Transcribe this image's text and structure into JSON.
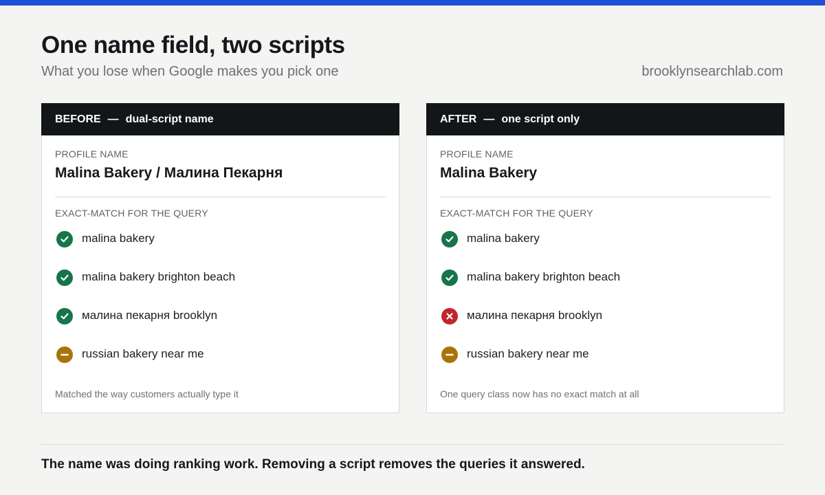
{
  "colors": {
    "accent": "#1d4ed8",
    "match": "#16754a",
    "no_match": "#c0262d",
    "partial": "#a8740a",
    "header_bg": "#131619"
  },
  "header": {
    "title": "One name field, two scripts",
    "subtitle": "What you lose when Google makes you pick one",
    "site": "brooklynsearchlab.com"
  },
  "cards": [
    {
      "tag": "BEFORE",
      "separator": "—",
      "heading": "dual-script name",
      "profile_label": "PROFILE NAME",
      "profile_name": "Malina Bakery / Малина Пекарня",
      "exact_label": "EXACT-MATCH FOR THE QUERY",
      "queries": [
        {
          "text": "malina bakery",
          "status": "match",
          "icon": "check-circle-icon"
        },
        {
          "text": "malina bakery brighton beach",
          "status": "match",
          "icon": "check-circle-icon"
        },
        {
          "text": "малина пекарня brooklyn",
          "status": "match",
          "icon": "check-circle-icon"
        },
        {
          "text": "russian bakery near me",
          "status": "partial",
          "icon": "minus-circle-icon"
        }
      ],
      "note": "Matched the way customers actually type it"
    },
    {
      "tag": "AFTER",
      "separator": "—",
      "heading": "one script only",
      "profile_label": "PROFILE NAME",
      "profile_name": "Malina Bakery",
      "exact_label": "EXACT-MATCH FOR THE QUERY",
      "queries": [
        {
          "text": "malina bakery",
          "status": "match",
          "icon": "check-circle-icon"
        },
        {
          "text": "malina bakery brighton beach",
          "status": "match",
          "icon": "check-circle-icon"
        },
        {
          "text": "малина пекарня brooklyn",
          "status": "no_match",
          "icon": "x-circle-icon"
        },
        {
          "text": "russian bakery near me",
          "status": "partial",
          "icon": "minus-circle-icon"
        }
      ],
      "note": "One query class now has no exact match at all"
    }
  ],
  "takeaway": "The name was doing ranking work. Removing a script removes the queries it answered."
}
